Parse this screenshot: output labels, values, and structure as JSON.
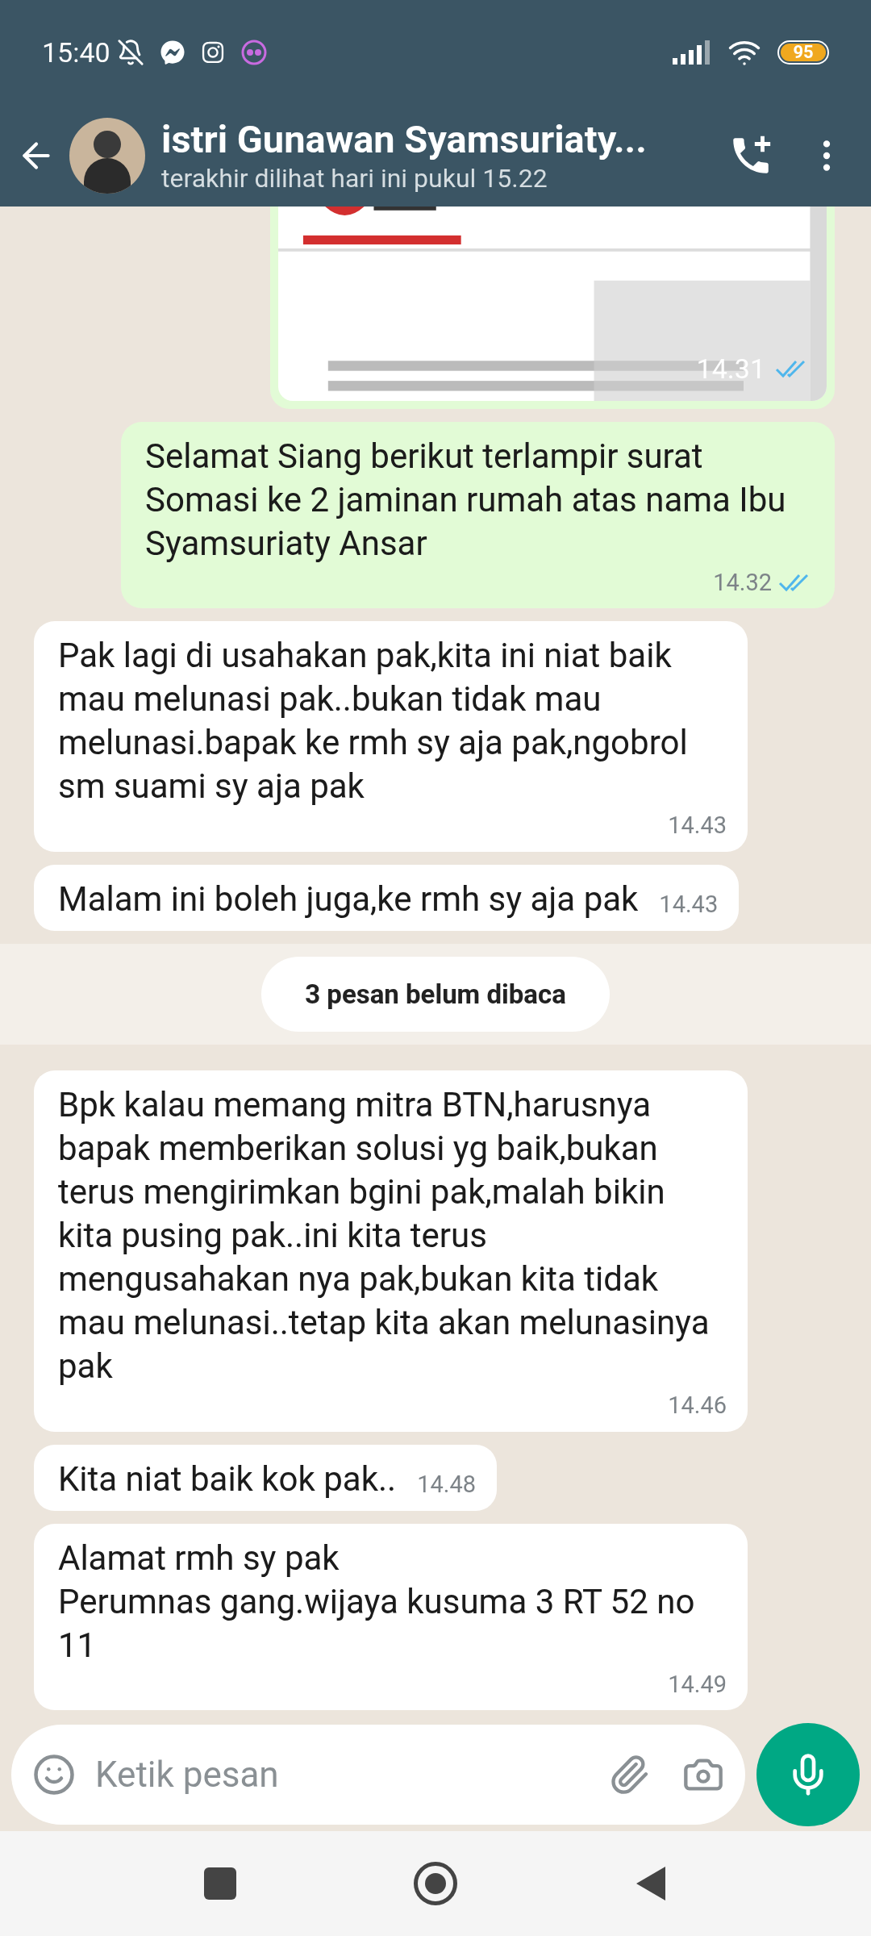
{
  "status_bar": {
    "time": "15:40",
    "battery": "95"
  },
  "header": {
    "name": "istri Gunawan Syamsuriaty...",
    "last_seen": "terakhir dilihat hari ini pukul 15.22"
  },
  "messages": [
    {
      "outgoing": true,
      "time": "14.31",
      "read": true
    },
    {
      "kind": "text",
      "outgoing": true,
      "text": "Selamat Siang berikut terlampir surat Somasi ke 2 jaminan rumah atas nama Ibu Syamsuriaty Ansar",
      "time": "14.32",
      "read": true
    },
    {
      "kind": "text",
      "outgoing": false,
      "text": "Pak lagi di usahakan pak,kita ini niat baik mau melunasi pak..bukan tidak mau melunasi.bapak ke rmh sy aja pak,ngobrol sm suami sy aja pak",
      "time": "14.43"
    },
    {
      "kind": "text",
      "outgoing": false,
      "text": "Malam ini boleh juga,ke rmh sy aja pak",
      "time": "14.43"
    },
    {
      "kind": "divider",
      "text": "3 pesan belum dibaca"
    },
    {
      "kind": "text",
      "outgoing": false,
      "text": "Bpk kalau memang mitra BTN,harusnya bapak memberikan solusi yg baik,bukan terus mengirimkan bgini pak,malah bikin kita pusing pak..ini kita terus mengusahakan nya pak,bukan kita tidak mau melunasi..tetap kita akan melunasinya pak",
      "time": "14.46"
    },
    {
      "kind": "text",
      "outgoing": false,
      "text": "Kita niat baik kok pak..",
      "time": "14.48"
    },
    {
      "kind": "text",
      "outgoing": false,
      "text": "Alamat rmh sy pak\nPerumnas gang.wijaya kusuma 3 RT 52 no 11",
      "time": "14.49"
    }
  ],
  "composer": {
    "placeholder": "Ketik pesan"
  }
}
